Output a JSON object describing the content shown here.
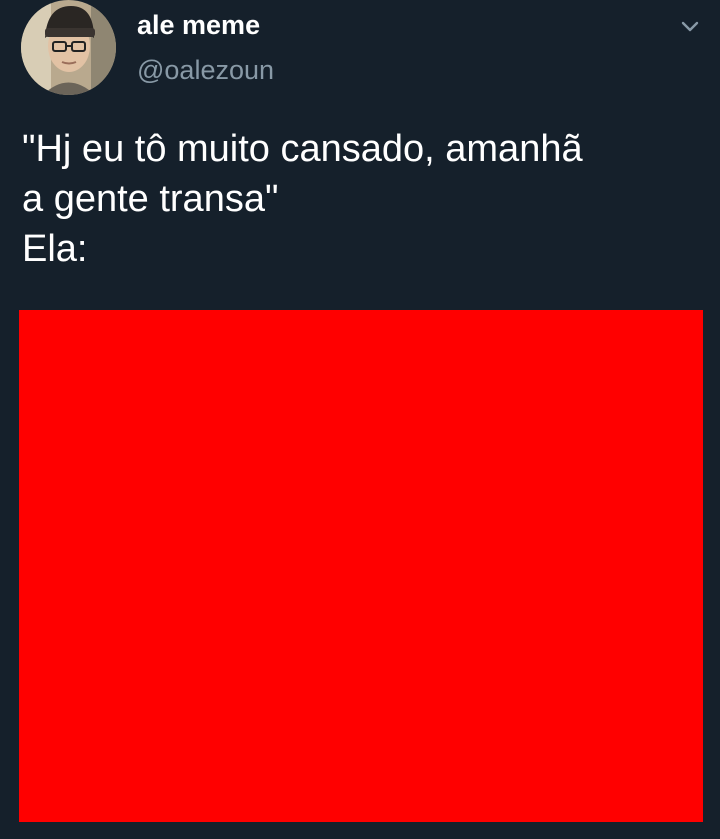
{
  "colors": {
    "background": "#15202b",
    "text_primary": "#ffffff",
    "text_secondary": "#8899a6",
    "media_fill": "#ff0000"
  },
  "author": {
    "display_name": "ale meme",
    "handle": "@oalezoun",
    "avatar_icon": "profile-photo"
  },
  "menu": {
    "icon": "chevron-down-icon"
  },
  "tweet": {
    "lines": [
      "\"Hj eu tô muito cansado, amanhã",
      "a gente transa\"",
      "Ela:"
    ]
  }
}
